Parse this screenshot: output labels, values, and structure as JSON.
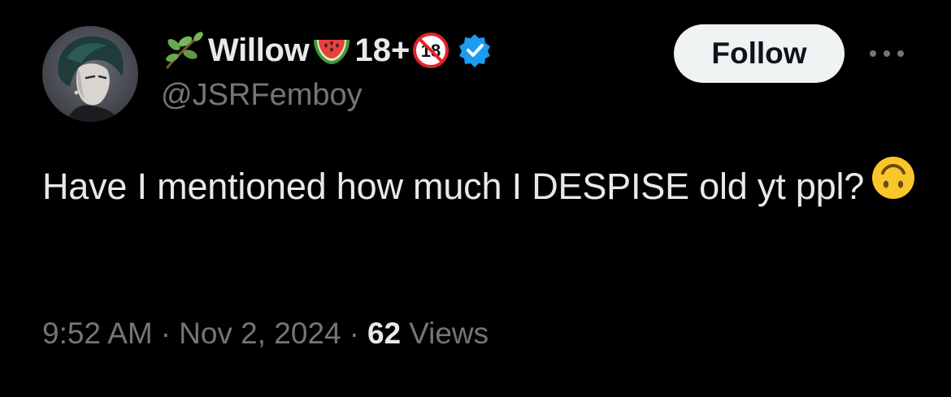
{
  "author": {
    "display_name": "Willow",
    "age_label": "18+",
    "handle": "@JSRFemboy",
    "verified": true,
    "icons": [
      "sprig-icon",
      "watermelon-icon",
      "no-under-18-icon",
      "verified-badge-icon"
    ]
  },
  "actions": {
    "follow_label": "Follow",
    "more_icon": "more-options-icon"
  },
  "tweet": {
    "text": "Have I mentioned how much I DESPISE old yt ppl?",
    "emoji": "upside-down-face-emoji"
  },
  "meta": {
    "time": "9:52 AM",
    "separator": "·",
    "date": "Nov 2, 2024",
    "views_count": "62",
    "views_label": "Views"
  },
  "colors": {
    "background": "#000000",
    "primary_text": "#e7e9ea",
    "secondary_text": "#71767b",
    "follow_bg": "#eff3f4",
    "verified": "#1d9bf0",
    "emoji": "#f9c62a"
  }
}
